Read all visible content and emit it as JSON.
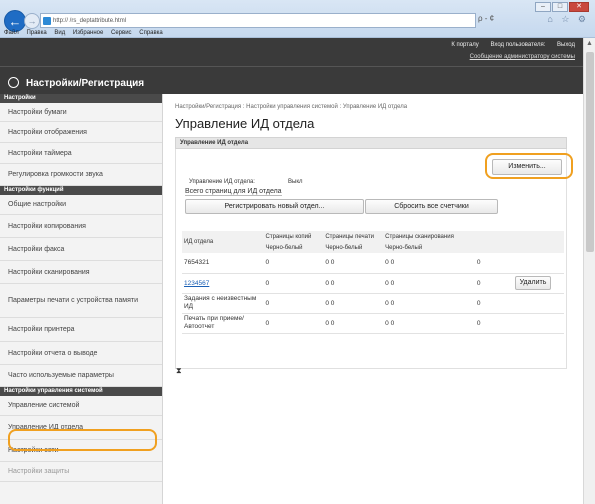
{
  "browser": {
    "url": "http://                    /rs_deptattribute.html",
    "window_buttons": [
      "–",
      "□",
      "✕"
    ],
    "menu": [
      "Файл",
      "Правка",
      "Вид",
      "Избранное",
      "Сервис",
      "Справка"
    ],
    "addr_tools": "ρ - ¢",
    "tab_icons": "⌂ ☆ ⚙"
  },
  "header": {
    "brand": "Настройки/Регистрация",
    "links": [
      "К порталу",
      "Вход пользователя:",
      "Выход"
    ],
    "message_link": "Сообщение администратору системы"
  },
  "sidebar": {
    "sections": [
      {
        "title": "Настройки",
        "items": [
          "Настройки бумаги",
          "Настройки отображения",
          "Настройки таймера",
          "Регулировка громкости звука"
        ]
      },
      {
        "title": "Настройки функций",
        "items": [
          "Общие настройки",
          "Настройки копирования",
          "Настройки факса",
          "Настройки сканирования",
          "Параметры печати с устройства памяти",
          "Настройки принтера",
          "Настройки отчета о выводе",
          "Часто используемые параметры"
        ]
      },
      {
        "title": "Настройки управления системой",
        "items": [
          "Управление системой",
          "Управление ИД отдела",
          "Настройки сети",
          "Настройки защиты"
        ]
      }
    ]
  },
  "main": {
    "breadcrumb": "Настройки/Регистрация : Настройки управления системой : Управление ИД отдела",
    "title": "Управление ИД отдела",
    "panel_title": "Управление ИД отдела",
    "edit_button": "Изменить...",
    "mgmt_label": "Управление ИД отдела:",
    "mgmt_value": "Выкл",
    "total_pages_link": "Всего страниц для ИД отдела",
    "register_button": "Регистрировать новый отдел...",
    "reset_button": "Сбросить все счетчики",
    "table": {
      "col_id": "ИД отдела",
      "col_copy": "Страницы копий",
      "col_print": "Страницы печати",
      "col_scan": "Страницы сканирования",
      "sub_copy": "Черно-белый",
      "sub_print": "Черно-белый",
      "sub_scan": "Черно-белый",
      "delete_label": "Удалить",
      "rows": [
        {
          "id": "7654321",
          "copy": "0",
          "print": "0  0",
          "scan": "0  0",
          "extra": "0"
        },
        {
          "id": "1234567",
          "copy": "0",
          "print": "0  0",
          "scan": "0  0",
          "extra": "0"
        },
        {
          "id": "Задания с неизвестным ИД",
          "copy": "0",
          "print": "0  0",
          "scan": "0  0",
          "extra": "0"
        },
        {
          "id": "Печать при приеме/Автоотчет",
          "copy": "0",
          "print": "0  0",
          "scan": "0  0",
          "extra": "0"
        }
      ]
    },
    "collapse_icon": "⧗"
  },
  "colors": {
    "header_bg": "#3a3a3a",
    "highlight_ring": "#f0a020",
    "link": "#1a5fb4",
    "browser_blue": "#1f6cc4"
  }
}
